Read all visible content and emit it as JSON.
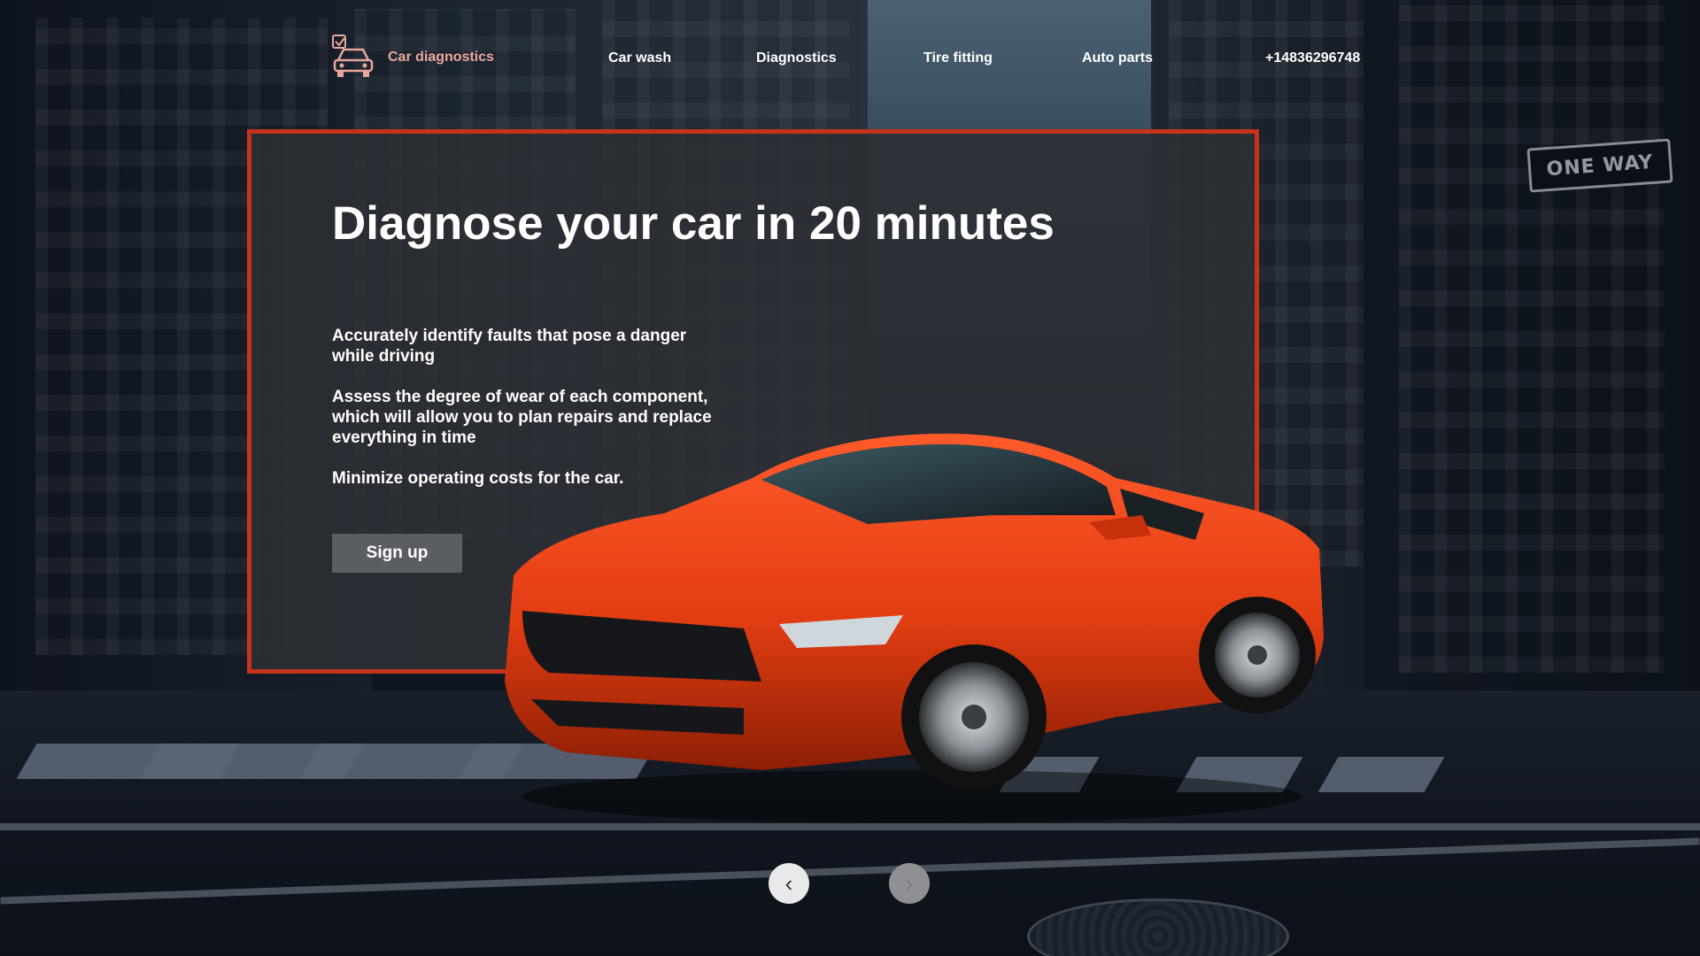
{
  "brand": {
    "name": "Car diagnostics",
    "accent": "#e9a79b",
    "border": "#c4331b"
  },
  "nav": {
    "links": [
      "Car wash",
      "Diagnostics",
      "Tire fitting",
      "Auto parts"
    ],
    "phone": "+14836296748"
  },
  "hero": {
    "title": "Diagnose your car in 20 minutes",
    "bullets": [
      "Accurately identify faults that pose a danger while driving",
      "Assess the degree of wear of each component, which will allow you to plan repairs and replace everything in time",
      "Minimize operating costs for the car."
    ],
    "cta_label": "Sign up"
  },
  "background": {
    "street_sign": "ONE WAY"
  },
  "carousel": {
    "prev_icon": "chevron-left-icon",
    "next_icon": "chevron-right-icon",
    "prev_glyph": "‹",
    "next_glyph": "›"
  }
}
